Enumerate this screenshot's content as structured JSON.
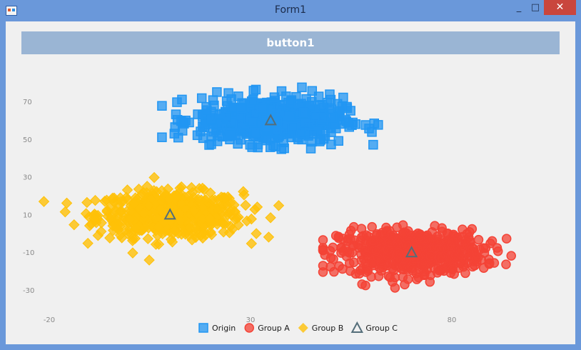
{
  "window": {
    "title": "Form1",
    "minimize": "_",
    "maximize": "□",
    "close": "✕"
  },
  "toolbar": {
    "button1_label": "button1"
  },
  "colors": {
    "origin": "#2196f3",
    "group_a": "#f44336",
    "group_b": "#ffc107",
    "group_c": "#546e7a"
  },
  "chart_data": {
    "type": "scatter",
    "title": "",
    "xlabel": "",
    "ylabel": "",
    "xlim": [
      -25,
      95
    ],
    "ylim": [
      -38,
      82
    ],
    "x_ticks": [
      -20,
      30,
      80
    ],
    "y_ticks": [
      70,
      50,
      30,
      10,
      -10,
      -30
    ],
    "grid": false,
    "legend": "bottom-center",
    "series": [
      {
        "name": "Origin",
        "marker": "square",
        "color": "#2196f3",
        "count": 600,
        "center": [
          35,
          60
        ],
        "spread": [
          9,
          6
        ],
        "x_range": [
          8,
          62
        ],
        "y_range": [
          41,
          82
        ]
      },
      {
        "name": "Group A",
        "marker": "circle",
        "color": "#f44336",
        "count": 600,
        "center": [
          70,
          -10
        ],
        "spread": [
          9,
          6
        ],
        "x_range": [
          48,
          96
        ],
        "y_range": [
          -37,
          18
        ]
      },
      {
        "name": "Group B",
        "marker": "diamond",
        "color": "#ffc107",
        "count": 600,
        "center": [
          10,
          10
        ],
        "spread": [
          9,
          6
        ],
        "x_range": [
          -24,
          37
        ],
        "y_range": [
          -22,
          37
        ]
      },
      {
        "name": "Group C",
        "marker": "triangle",
        "color": "#546e7a",
        "points": [
          [
            35,
            60
          ],
          [
            70,
            -10
          ],
          [
            10,
            10
          ]
        ]
      }
    ]
  }
}
